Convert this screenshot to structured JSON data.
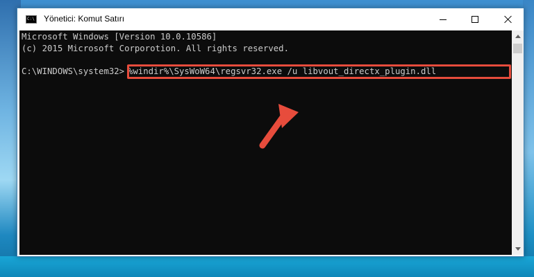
{
  "window": {
    "title": "Yönetici: Komut Satırı",
    "icon": "cmd-icon",
    "controls": {
      "minimize": "minimize-icon",
      "maximize": "maximize-icon",
      "close": "close-icon"
    }
  },
  "console": {
    "line1": "Microsoft Windows [Version 10.0.10586]",
    "line2": "(c) 2015 Microsoft Corporotion. All rights reserved.",
    "prompt": "C:\\WINDOWS\\system32>",
    "command": "%windir%\\SysWoW64\\regsvr32.exe /u libvout_directx_plugin.dll"
  },
  "annotation": {
    "highlight_color": "#e74c3c",
    "arrow_icon": "arrow-up-icon"
  },
  "colors": {
    "console_bg": "#0c0c0c",
    "console_text": "#cccccc"
  }
}
